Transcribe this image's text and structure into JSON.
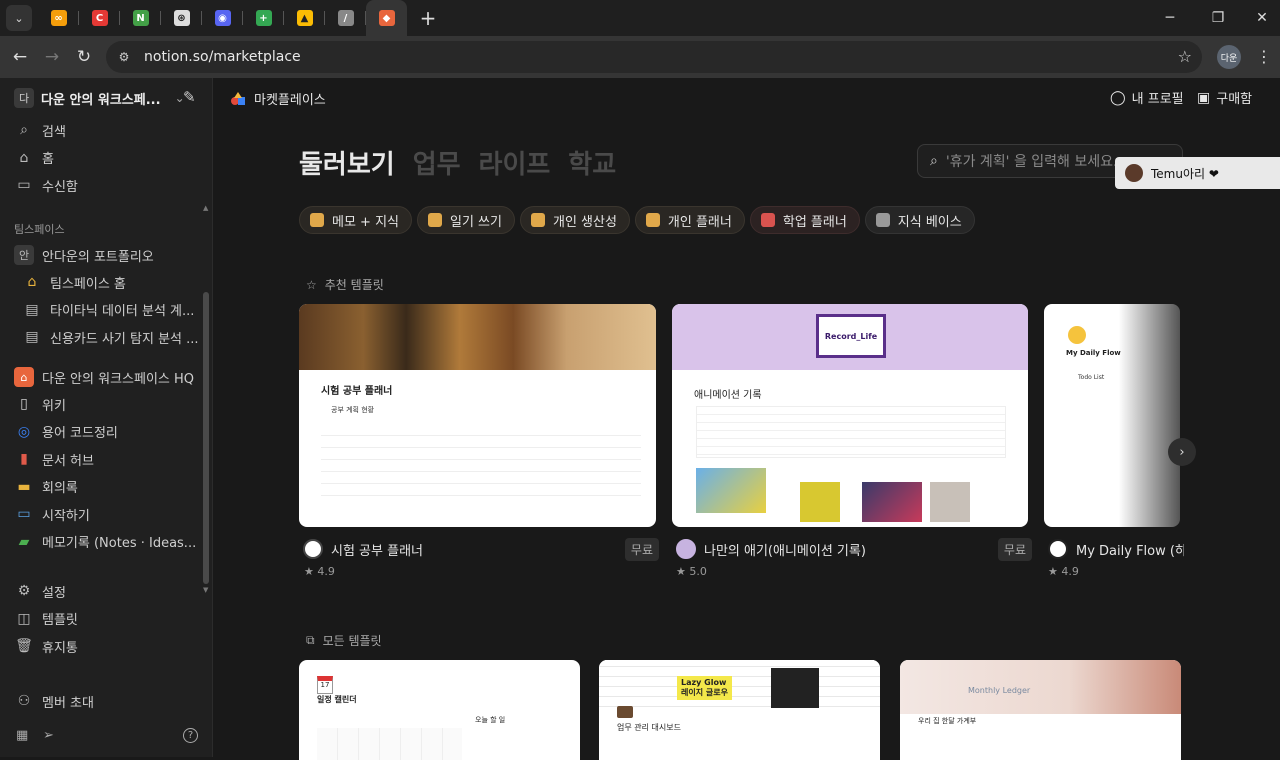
{
  "browser": {
    "tabs": [
      {
        "icon": "infinity-icon",
        "color": "#f59e0b",
        "label": "∞"
      },
      {
        "icon": "c-app-icon",
        "color": "#e53935",
        "label": "C"
      },
      {
        "icon": "n-app-icon",
        "color": "#43a047",
        "label": "N"
      },
      {
        "icon": "openai-icon",
        "color": "#dddddd",
        "label": "⊛"
      },
      {
        "icon": "discord-icon",
        "color": "#5865f2",
        "label": "◉"
      },
      {
        "icon": "sheets-icon",
        "color": "#34a853",
        "label": "+"
      },
      {
        "icon": "drive-icon",
        "color": "#fbbc04",
        "label": "▲"
      },
      {
        "icon": "slash-icon",
        "color": "#888888",
        "label": "/"
      },
      {
        "icon": "notion-marketplace-icon",
        "color": "#e8663d",
        "label": "◆"
      }
    ],
    "url": "notion.so/marketplace",
    "profile": "다운"
  },
  "sidebar": {
    "workspace": {
      "avatar": "다",
      "name": "다운 안의 워크스페..."
    },
    "nav": [
      {
        "icon": "search-icon",
        "label": "검색"
      },
      {
        "icon": "home-icon",
        "label": "홈"
      },
      {
        "icon": "inbox-icon",
        "label": "수신함"
      }
    ],
    "teamspace_label": "팀스페이스",
    "portfolio": {
      "avatar": "안",
      "label": "안다운의 포트폴리오"
    },
    "portfolio_items": [
      {
        "icon": "house-icon",
        "label": "팀스페이스 홈"
      },
      {
        "icon": "page-icon",
        "label": "타이타닉 데이터 분석 계..."
      },
      {
        "icon": "page-icon",
        "label": "신용카드 사기 탐지 분석 ..."
      }
    ],
    "hq": {
      "label": "다운 안의 워크스페이스 HQ"
    },
    "hq_items": [
      {
        "icon": "book-icon",
        "label": "위키"
      },
      {
        "icon": "target-icon",
        "label": "용어 코드정리"
      },
      {
        "icon": "document-icon",
        "label": "문서 허브"
      },
      {
        "icon": "folder-icon",
        "label": "회의록"
      },
      {
        "icon": "laptop-icon",
        "label": "시작하기"
      },
      {
        "icon": "note-icon",
        "label": "메모기록 (Notes · Ideas..."
      }
    ],
    "bottom": [
      {
        "icon": "gear-icon",
        "label": "설정"
      },
      {
        "icon": "template-icon",
        "label": "템플릿"
      },
      {
        "icon": "trash-icon",
        "label": "휴지통"
      }
    ],
    "invite": "멤버 초대"
  },
  "topbar": {
    "title": "마켓플레이스",
    "profile": "내 프로필",
    "purchases": "구매함"
  },
  "categories": [
    "둘러보기",
    "업무",
    "라이프",
    "학교"
  ],
  "search_placeholder": "'휴가 계획' 을 입력해 보세요.",
  "pills": [
    {
      "label": "메모 + 지식",
      "color": "#e0a84a"
    },
    {
      "label": "일기 쓰기",
      "color": "#e0a84a"
    },
    {
      "label": "개인 생산성",
      "color": "#e0a84a"
    },
    {
      "label": "개인 플래너",
      "color": "#e0a84a"
    },
    {
      "label": "학업 플래너",
      "color": "#d9534f"
    },
    {
      "label": "지식 베이스",
      "color": "#999999"
    }
  ],
  "featured_heading": "추천 템플릿",
  "featured": [
    {
      "title": "시험 공부 플래너",
      "price": "무료",
      "rating": "4.9",
      "preview_title": "시험 공부 플래너",
      "preview_sub": "공부 계획 현황"
    },
    {
      "title": "나만의 애기(애니메이션 기록)",
      "price": "무료",
      "rating": "5.0",
      "preview_title": "애니메이션 기록",
      "preview_badge": "Record_Life"
    },
    {
      "title": "My Daily Flow (하루",
      "price": "",
      "rating": "4.9",
      "preview_title": "My Daily Flow",
      "preview_sub": "Todo List"
    }
  ],
  "all_heading": "모든 템플릿",
  "all": [
    {
      "preview_title": "일정 캘린더",
      "side": "오늘 할 일"
    },
    {
      "preview_title": "업무 관리 대시보드",
      "banner": "Lazy Glow\n레이지 글로우"
    },
    {
      "preview_title": "우리 집 한달 가계부",
      "banner": "Monthly Ledger"
    }
  ],
  "popup": {
    "label": "Temu아리 ❤"
  }
}
